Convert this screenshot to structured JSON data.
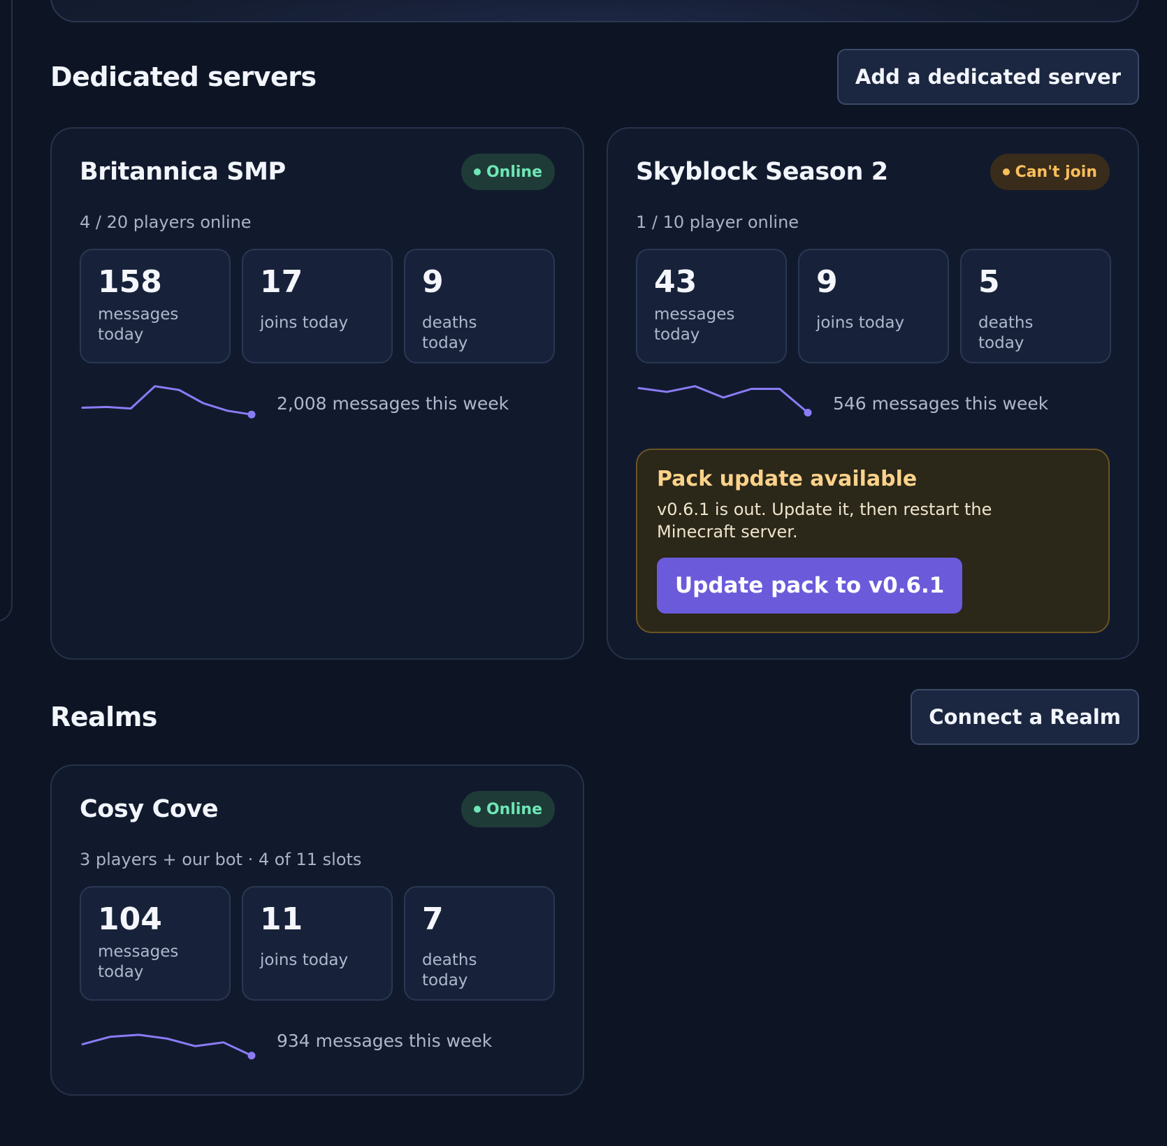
{
  "dedicated": {
    "title": "Dedicated servers",
    "add_button": "Add a dedicated server",
    "servers": [
      {
        "name": "Britannica SMP",
        "status": "Online",
        "players": "4 / 20 players online",
        "stats": [
          {
            "value": "158",
            "label": "messages today"
          },
          {
            "value": "17",
            "label": "joins today"
          },
          {
            "value": "9",
            "label": "deaths today"
          }
        ],
        "week": "2,008 messages this week",
        "trend": [
          0.38,
          0.4,
          0.36,
          0.95,
          0.85,
          0.5,
          0.3,
          0.2
        ]
      },
      {
        "name": "Skyblock Season 2",
        "status": "Can't join",
        "players": "1 / 10 player online",
        "stats": [
          {
            "value": "43",
            "label": "messages today"
          },
          {
            "value": "9",
            "label": "joins today"
          },
          {
            "value": "5",
            "label": "deaths today"
          }
        ],
        "week": "546 messages this week",
        "trend": [
          0.9,
          0.8,
          0.95,
          0.65,
          0.88,
          0.88,
          0.25
        ],
        "notice": {
          "title": "Pack update available",
          "body": "v0.6.1 is out. Update it, then restart the Minecraft server.",
          "button": "Update pack to v0.6.1"
        }
      }
    ]
  },
  "realms": {
    "title": "Realms",
    "connect_button": "Connect a Realm",
    "items": [
      {
        "name": "Cosy Cove",
        "status": "Online",
        "players": "3 players + our bot · 4 of 11 slots",
        "stats": [
          {
            "value": "104",
            "label": "messages today"
          },
          {
            "value": "11",
            "label": "joins today"
          },
          {
            "value": "7",
            "label": "deaths today"
          }
        ],
        "week": "934 messages this week",
        "trend": [
          0.4,
          0.6,
          0.65,
          0.55,
          0.35,
          0.45,
          0.1
        ]
      }
    ]
  },
  "colors": {
    "accent": "#6b5bdb",
    "sparkline": "#8b7cf6",
    "online": "#6ee7b7",
    "warning": "#fbbf5a"
  },
  "icons": {
    "status_dot": "status-dot-icon"
  }
}
